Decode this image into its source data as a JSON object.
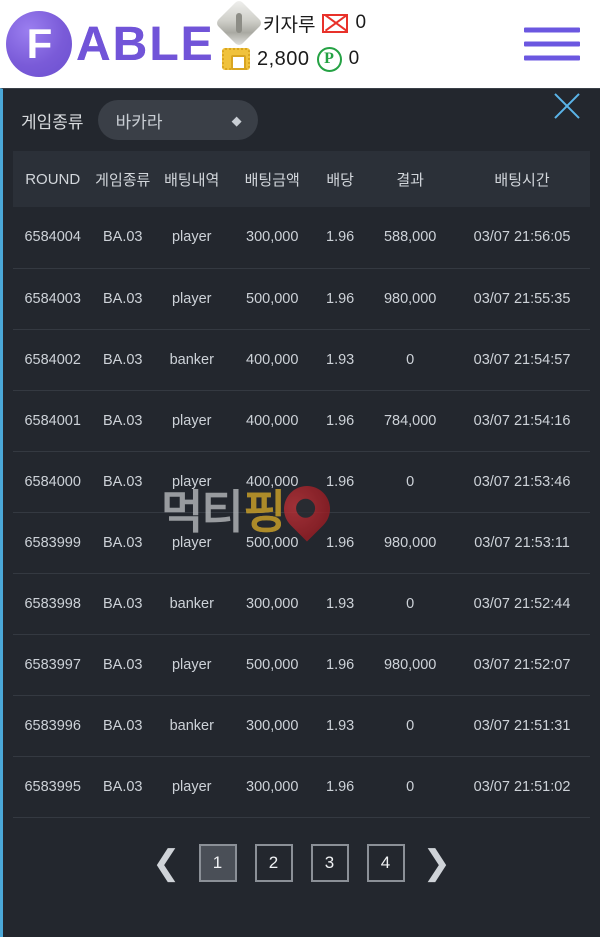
{
  "header": {
    "logo_mark": "F",
    "logo_text": "ABLE",
    "rank_icon": "diamond-rank-icon",
    "username": "키자루",
    "mail_icon": "envelope-icon",
    "mail_count": "0",
    "wallet_icon": "wallet-icon",
    "balance": "2,800",
    "point_icon": "point-icon",
    "point_count": "0",
    "menu_icon": "hamburger-menu-icon"
  },
  "filter": {
    "label": "게임종류",
    "selected": "바카라",
    "chevron": "▲▼",
    "close_icon": "close-icon"
  },
  "table": {
    "columns": [
      "ROUND",
      "게임종류",
      "배팅내역",
      "배팅금액",
      "배당",
      "결과",
      "배팅시간"
    ],
    "rows": [
      {
        "round": "6584004",
        "game": "BA.03",
        "bet": "player",
        "amount": "300,000",
        "odds": "1.96",
        "result": "588,000",
        "time": "03/07 21:56:05"
      },
      {
        "round": "6584003",
        "game": "BA.03",
        "bet": "player",
        "amount": "500,000",
        "odds": "1.96",
        "result": "980,000",
        "time": "03/07 21:55:35"
      },
      {
        "round": "6584002",
        "game": "BA.03",
        "bet": "banker",
        "amount": "400,000",
        "odds": "1.93",
        "result": "0",
        "time": "03/07 21:54:57"
      },
      {
        "round": "6584001",
        "game": "BA.03",
        "bet": "player",
        "amount": "400,000",
        "odds": "1.96",
        "result": "784,000",
        "time": "03/07 21:54:16"
      },
      {
        "round": "6584000",
        "game": "BA.03",
        "bet": "player",
        "amount": "400,000",
        "odds": "1.96",
        "result": "0",
        "time": "03/07 21:53:46"
      },
      {
        "round": "6583999",
        "game": "BA.03",
        "bet": "player",
        "amount": "500,000",
        "odds": "1.96",
        "result": "980,000",
        "time": "03/07 21:53:11"
      },
      {
        "round": "6583998",
        "game": "BA.03",
        "bet": "banker",
        "amount": "300,000",
        "odds": "1.93",
        "result": "0",
        "time": "03/07 21:52:44"
      },
      {
        "round": "6583997",
        "game": "BA.03",
        "bet": "player",
        "amount": "500,000",
        "odds": "1.96",
        "result": "980,000",
        "time": "03/07 21:52:07"
      },
      {
        "round": "6583996",
        "game": "BA.03",
        "bet": "banker",
        "amount": "300,000",
        "odds": "1.93",
        "result": "0",
        "time": "03/07 21:51:31"
      },
      {
        "round": "6583995",
        "game": "BA.03",
        "bet": "player",
        "amount": "300,000",
        "odds": "1.96",
        "result": "0",
        "time": "03/07 21:51:02"
      }
    ]
  },
  "watermark": {
    "text_a": "먹티",
    "text_b": "핑",
    "pin_icon": "map-pin-icon"
  },
  "pagination": {
    "prev": "❮",
    "next": "❯",
    "pages": [
      "1",
      "2",
      "3",
      "4"
    ],
    "current": "1"
  },
  "colors": {
    "accent_purple": "#6b57e0",
    "panel_bg": "#23272e",
    "border_blue": "#4ba8d8",
    "header_row": "#2b3038"
  }
}
